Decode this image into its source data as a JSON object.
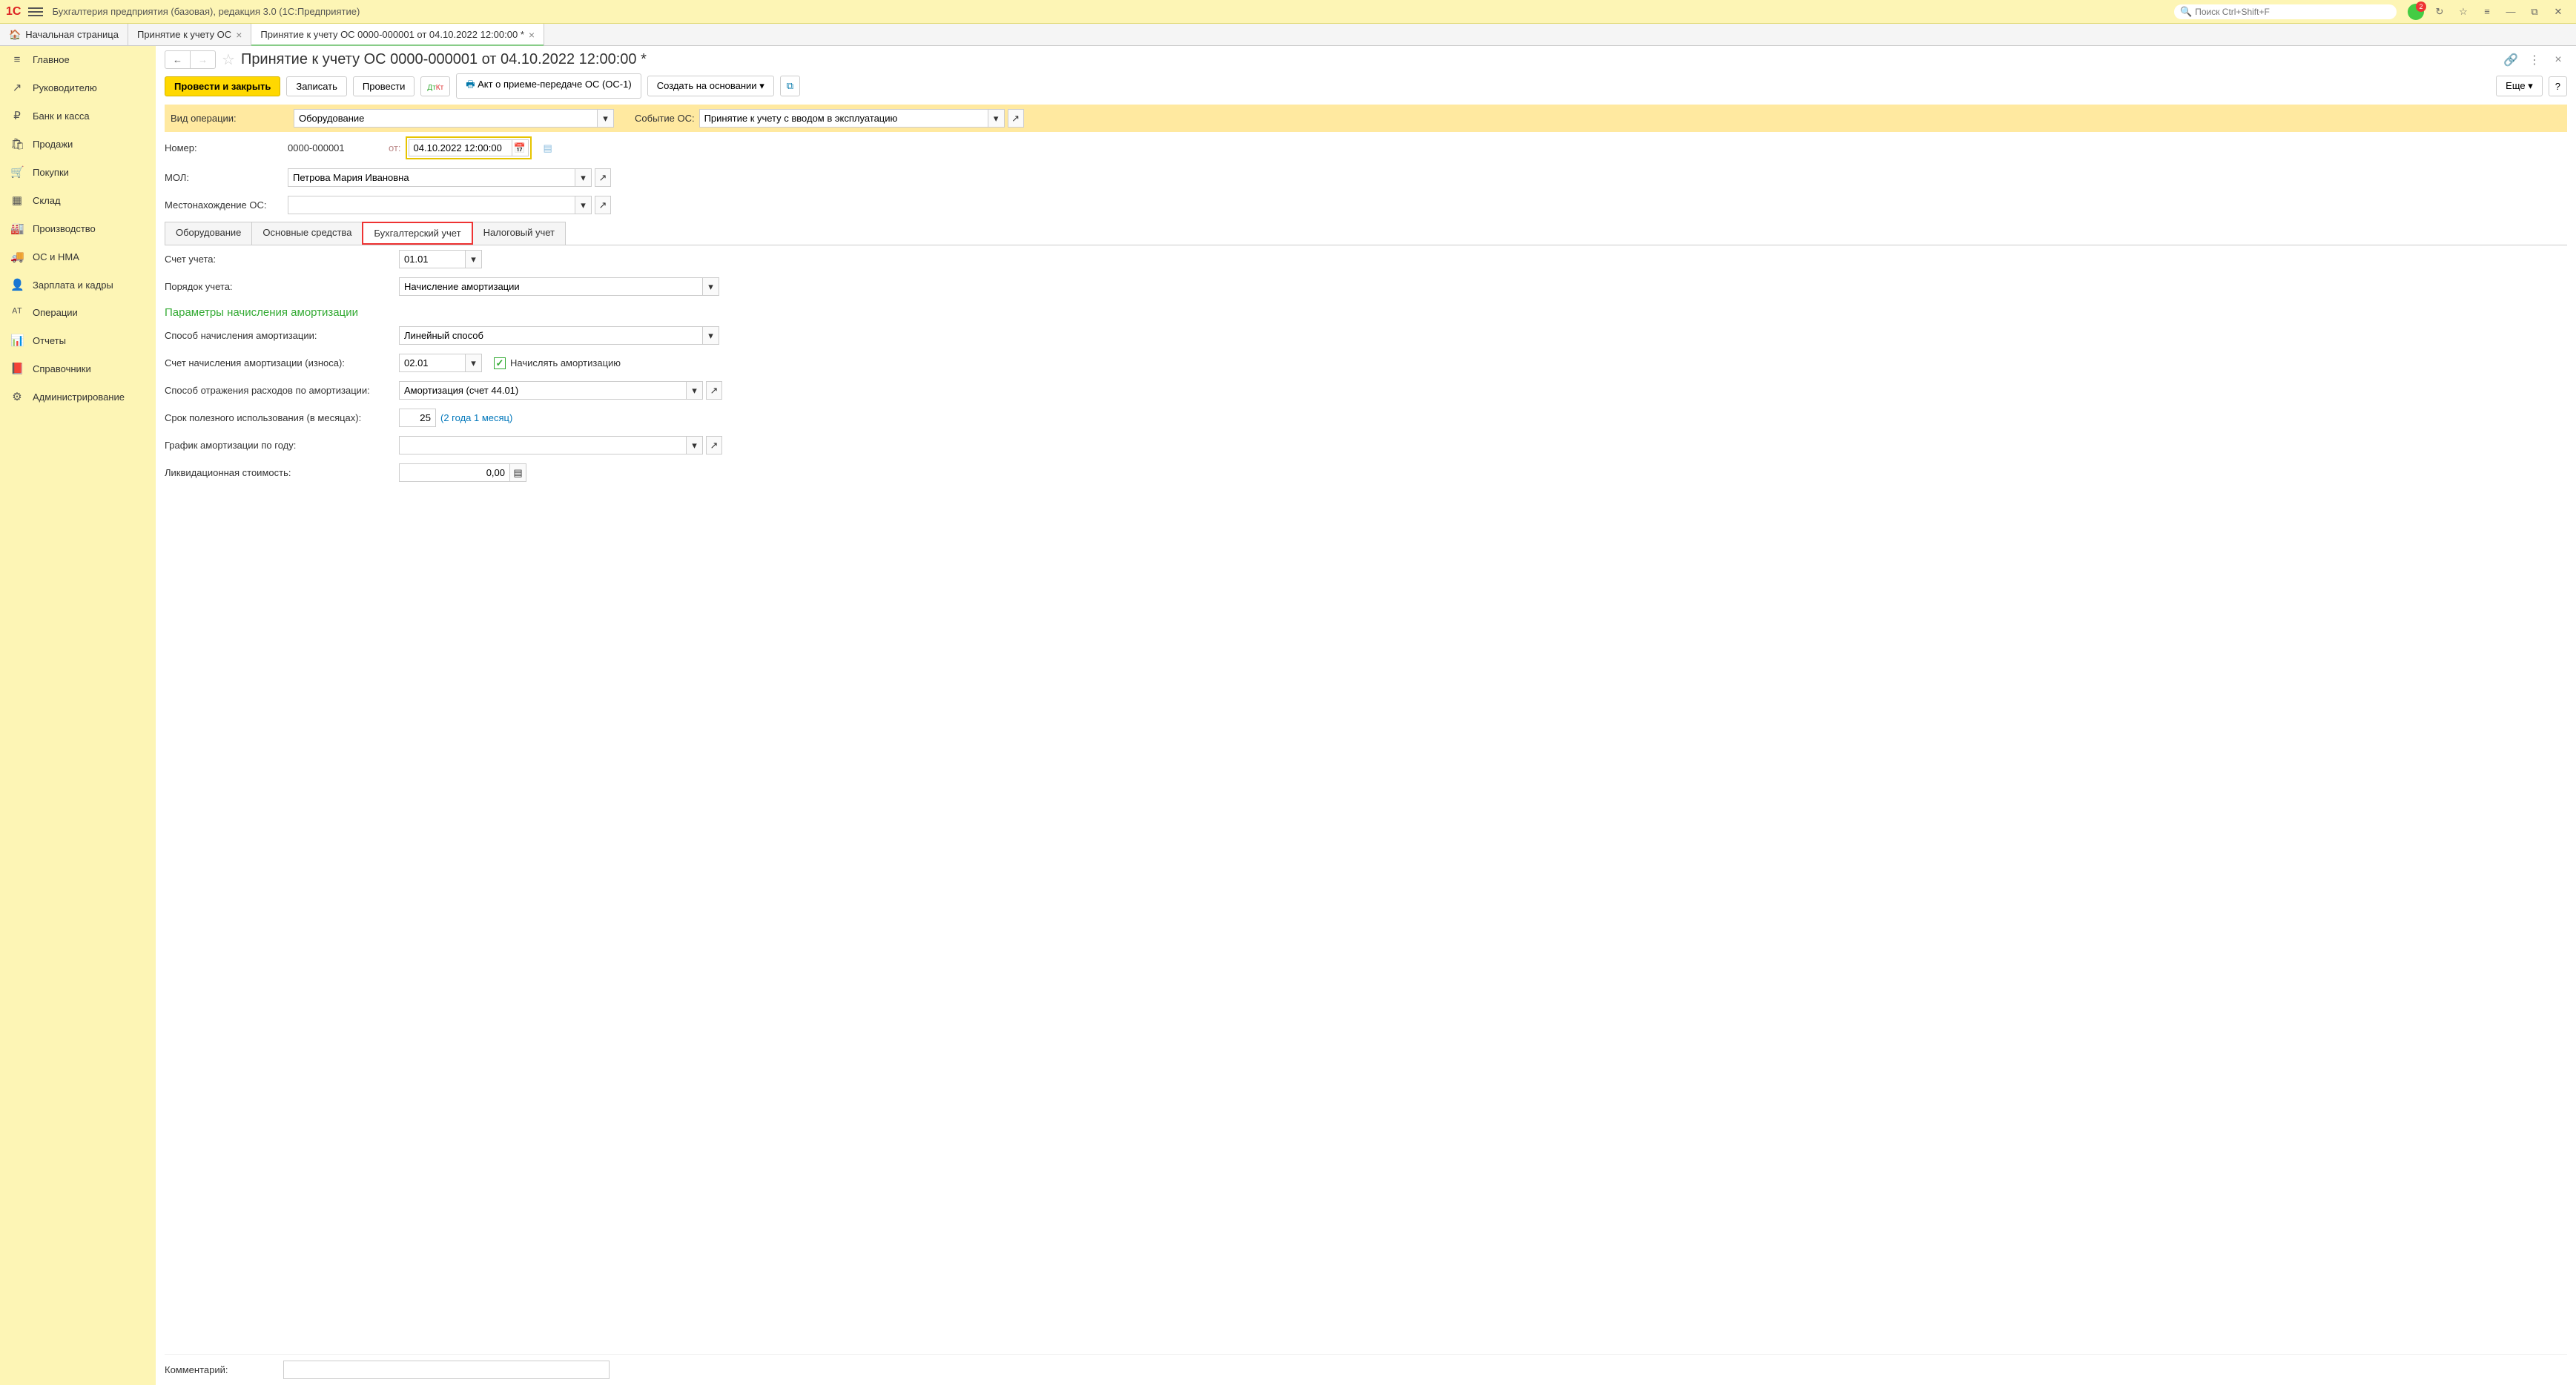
{
  "titlebar": {
    "app_title": "Бухгалтерия предприятия (базовая), редакция 3.0  (1С:Предприятие)",
    "search_placeholder": "Поиск Ctrl+Shift+F",
    "notification_count": "2"
  },
  "tabs": {
    "home": "Начальная страница",
    "t1": "Принятие к учету ОС",
    "t2": "Принятие к учету ОС 0000-000001 от 04.10.2022 12:00:00 *"
  },
  "sidebar": {
    "items": [
      {
        "label": "Главное",
        "icon": "≡"
      },
      {
        "label": "Руководителю",
        "icon": "↗"
      },
      {
        "label": "Банк и касса",
        "icon": "₽"
      },
      {
        "label": "Продажи",
        "icon": "🛍"
      },
      {
        "label": "Покупки",
        "icon": "🛒"
      },
      {
        "label": "Склад",
        "icon": "▦"
      },
      {
        "label": "Производство",
        "icon": "🏭"
      },
      {
        "label": "ОС и НМА",
        "icon": "🚚"
      },
      {
        "label": "Зарплата и кадры",
        "icon": "👤"
      },
      {
        "label": "Операции",
        "icon": "ᴬᵀ"
      },
      {
        "label": "Отчеты",
        "icon": "📊"
      },
      {
        "label": "Справочники",
        "icon": "📕"
      },
      {
        "label": "Администрирование",
        "icon": "⚙"
      }
    ]
  },
  "doc": {
    "title": "Принятие к учету ОС 0000-000001 от 04.10.2022 12:00:00 *"
  },
  "toolbar": {
    "post_close": "Провести и закрыть",
    "save": "Записать",
    "post": "Провести",
    "dtkt": "Дт Кт",
    "print": "Акт о приеме-передаче ОС (ОС-1)",
    "create_based": "Создать на основании",
    "more": "Еще",
    "help": "?"
  },
  "form": {
    "op_type_label": "Вид операции:",
    "op_type_value": "Оборудование",
    "event_label": "Событие ОС:",
    "event_value": "Принятие к учету с вводом в эксплуатацию",
    "number_label": "Номер:",
    "number_value": "0000-000001",
    "date_label": "от:",
    "date_value": "04.10.2022 12:00:00",
    "mol_label": "МОЛ:",
    "mol_value": "Петрова Мария Ивановна",
    "location_label": "Местонахождение ОС:",
    "location_value": ""
  },
  "inner_tabs": {
    "t1": "Оборудование",
    "t2": "Основные средства",
    "t3": "Бухгалтерский учет",
    "t4": "Налоговый учет"
  },
  "accounting": {
    "account_label": "Счет учета:",
    "account_value": "01.01",
    "procedure_label": "Порядок учета:",
    "procedure_value": "Начисление амортизации",
    "section": "Параметры начисления амортизации",
    "method_label": "Способ начисления амортизации:",
    "method_value": "Линейный способ",
    "dep_account_label": "Счет начисления амортизации (износа):",
    "dep_account_value": "02.01",
    "calc_dep_label": "Начислять амортизацию",
    "exp_method_label": "Способ отражения расходов по амортизации:",
    "exp_method_value": "Амортизация (счет 44.01)",
    "useful_life_label": "Срок полезного использования (в месяцах):",
    "useful_life_value": "25",
    "useful_life_hint": "(2 года 1 месяц)",
    "schedule_label": "График амортизации по году:",
    "schedule_value": "",
    "liquidation_label": "Ликвидационная стоимость:",
    "liquidation_value": "0,00"
  },
  "comment": {
    "label": "Комментарий:",
    "value": ""
  }
}
